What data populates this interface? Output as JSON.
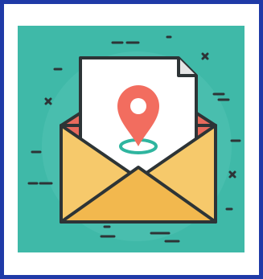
{
  "image": {
    "subject": "envelope-with-location-pin-letter",
    "icons": [
      "envelope-icon",
      "letter-icon",
      "location-pin-icon"
    ],
    "colors": {
      "frame_border": "#1f3aa7",
      "tile_background": "#3fb9a8",
      "tile_glow": "#5cc9b9",
      "outline": "#2d3436",
      "envelope_body": "#f6c96b",
      "envelope_flap": "#f2b84e",
      "envelope_inner": "#e96a5c",
      "letter": "#ffffff",
      "letter_fold": "#e5e5e5",
      "pin": "#f26d5f",
      "pin_ring": "#2fb59f"
    }
  }
}
